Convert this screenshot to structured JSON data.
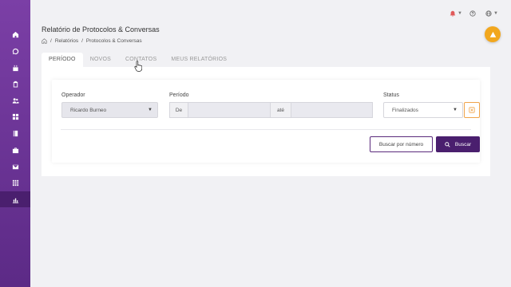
{
  "page": {
    "title": "Relatório de Protocolos & Conversas"
  },
  "breadcrumb": {
    "items": [
      "Relatórios",
      "Protocolos & Conversas"
    ],
    "separator": "/"
  },
  "tabs": [
    {
      "label": "PERÍODO",
      "active": true
    },
    {
      "label": "NOVOS",
      "active": false
    },
    {
      "label": "CONTATOS",
      "active": false
    },
    {
      "label": "MEUS RELATÓRIOS",
      "active": false
    }
  ],
  "filters": {
    "operator": {
      "label": "Operador",
      "value": "Ricardo Burneo"
    },
    "period": {
      "label": "Período",
      "from_label": "De",
      "to_label": "até",
      "from_value": "",
      "to_value": ""
    },
    "status": {
      "label": "Status",
      "value": "Finalizados"
    }
  },
  "actions": {
    "search_by_number": "Buscar por número",
    "search": "Buscar"
  },
  "sidebar": {
    "items": [
      {
        "icon": "home-icon",
        "active": false
      },
      {
        "icon": "whatsapp-icon",
        "active": false
      },
      {
        "icon": "calendar-icon",
        "active": false
      },
      {
        "icon": "clipboard-icon",
        "active": false
      },
      {
        "icon": "users-icon",
        "active": false
      },
      {
        "icon": "grid-icon",
        "active": false
      },
      {
        "icon": "book-icon",
        "active": false
      },
      {
        "icon": "briefcase-icon",
        "active": false
      },
      {
        "icon": "mail-icon",
        "active": false
      },
      {
        "icon": "apps-icon",
        "active": false
      },
      {
        "icon": "chart-icon",
        "active": true
      }
    ]
  },
  "topbar": {
    "icons": [
      "bell-icon",
      "help-icon",
      "globe-icon"
    ]
  },
  "colors": {
    "sidebar_top": "#7b3fa6",
    "sidebar_bottom": "#5c2a86",
    "primary": "#4a1f6e",
    "warning": "#f2a71e",
    "bell": "#e05a5a"
  }
}
